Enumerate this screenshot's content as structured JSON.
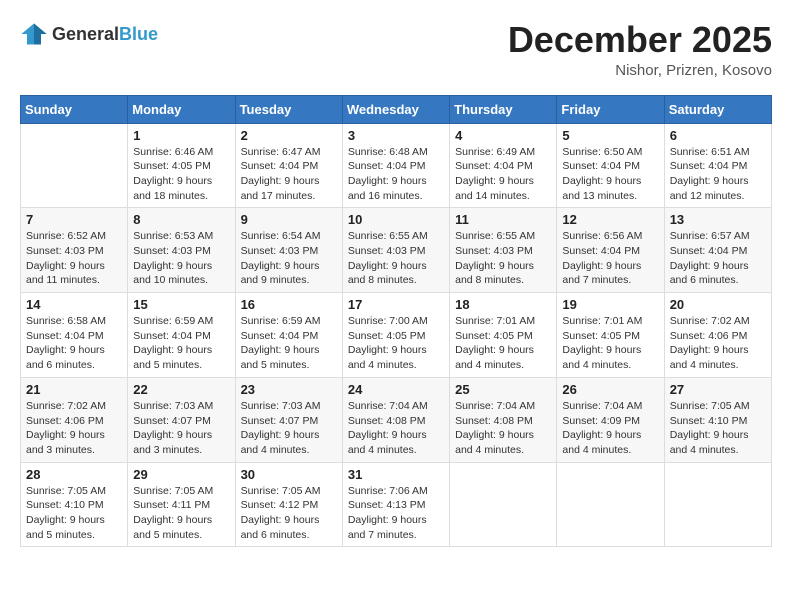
{
  "logo": {
    "general": "General",
    "blue": "Blue"
  },
  "title": {
    "month": "December 2025",
    "location": "Nishor, Prizren, Kosovo"
  },
  "weekdays": [
    "Sunday",
    "Monday",
    "Tuesday",
    "Wednesday",
    "Thursday",
    "Friday",
    "Saturday"
  ],
  "weeks": [
    [
      {
        "day": "",
        "info": ""
      },
      {
        "day": "1",
        "info": "Sunrise: 6:46 AM\nSunset: 4:05 PM\nDaylight: 9 hours\nand 18 minutes."
      },
      {
        "day": "2",
        "info": "Sunrise: 6:47 AM\nSunset: 4:04 PM\nDaylight: 9 hours\nand 17 minutes."
      },
      {
        "day": "3",
        "info": "Sunrise: 6:48 AM\nSunset: 4:04 PM\nDaylight: 9 hours\nand 16 minutes."
      },
      {
        "day": "4",
        "info": "Sunrise: 6:49 AM\nSunset: 4:04 PM\nDaylight: 9 hours\nand 14 minutes."
      },
      {
        "day": "5",
        "info": "Sunrise: 6:50 AM\nSunset: 4:04 PM\nDaylight: 9 hours\nand 13 minutes."
      },
      {
        "day": "6",
        "info": "Sunrise: 6:51 AM\nSunset: 4:04 PM\nDaylight: 9 hours\nand 12 minutes."
      }
    ],
    [
      {
        "day": "7",
        "info": "Sunrise: 6:52 AM\nSunset: 4:03 PM\nDaylight: 9 hours\nand 11 minutes."
      },
      {
        "day": "8",
        "info": "Sunrise: 6:53 AM\nSunset: 4:03 PM\nDaylight: 9 hours\nand 10 minutes."
      },
      {
        "day": "9",
        "info": "Sunrise: 6:54 AM\nSunset: 4:03 PM\nDaylight: 9 hours\nand 9 minutes."
      },
      {
        "day": "10",
        "info": "Sunrise: 6:55 AM\nSunset: 4:03 PM\nDaylight: 9 hours\nand 8 minutes."
      },
      {
        "day": "11",
        "info": "Sunrise: 6:55 AM\nSunset: 4:03 PM\nDaylight: 9 hours\nand 8 minutes."
      },
      {
        "day": "12",
        "info": "Sunrise: 6:56 AM\nSunset: 4:04 PM\nDaylight: 9 hours\nand 7 minutes."
      },
      {
        "day": "13",
        "info": "Sunrise: 6:57 AM\nSunset: 4:04 PM\nDaylight: 9 hours\nand 6 minutes."
      }
    ],
    [
      {
        "day": "14",
        "info": "Sunrise: 6:58 AM\nSunset: 4:04 PM\nDaylight: 9 hours\nand 6 minutes."
      },
      {
        "day": "15",
        "info": "Sunrise: 6:59 AM\nSunset: 4:04 PM\nDaylight: 9 hours\nand 5 minutes."
      },
      {
        "day": "16",
        "info": "Sunrise: 6:59 AM\nSunset: 4:04 PM\nDaylight: 9 hours\nand 5 minutes."
      },
      {
        "day": "17",
        "info": "Sunrise: 7:00 AM\nSunset: 4:05 PM\nDaylight: 9 hours\nand 4 minutes."
      },
      {
        "day": "18",
        "info": "Sunrise: 7:01 AM\nSunset: 4:05 PM\nDaylight: 9 hours\nand 4 minutes."
      },
      {
        "day": "19",
        "info": "Sunrise: 7:01 AM\nSunset: 4:05 PM\nDaylight: 9 hours\nand 4 minutes."
      },
      {
        "day": "20",
        "info": "Sunrise: 7:02 AM\nSunset: 4:06 PM\nDaylight: 9 hours\nand 4 minutes."
      }
    ],
    [
      {
        "day": "21",
        "info": "Sunrise: 7:02 AM\nSunset: 4:06 PM\nDaylight: 9 hours\nand 3 minutes."
      },
      {
        "day": "22",
        "info": "Sunrise: 7:03 AM\nSunset: 4:07 PM\nDaylight: 9 hours\nand 3 minutes."
      },
      {
        "day": "23",
        "info": "Sunrise: 7:03 AM\nSunset: 4:07 PM\nDaylight: 9 hours\nand 4 minutes."
      },
      {
        "day": "24",
        "info": "Sunrise: 7:04 AM\nSunset: 4:08 PM\nDaylight: 9 hours\nand 4 minutes."
      },
      {
        "day": "25",
        "info": "Sunrise: 7:04 AM\nSunset: 4:08 PM\nDaylight: 9 hours\nand 4 minutes."
      },
      {
        "day": "26",
        "info": "Sunrise: 7:04 AM\nSunset: 4:09 PM\nDaylight: 9 hours\nand 4 minutes."
      },
      {
        "day": "27",
        "info": "Sunrise: 7:05 AM\nSunset: 4:10 PM\nDaylight: 9 hours\nand 4 minutes."
      }
    ],
    [
      {
        "day": "28",
        "info": "Sunrise: 7:05 AM\nSunset: 4:10 PM\nDaylight: 9 hours\nand 5 minutes."
      },
      {
        "day": "29",
        "info": "Sunrise: 7:05 AM\nSunset: 4:11 PM\nDaylight: 9 hours\nand 5 minutes."
      },
      {
        "day": "30",
        "info": "Sunrise: 7:05 AM\nSunset: 4:12 PM\nDaylight: 9 hours\nand 6 minutes."
      },
      {
        "day": "31",
        "info": "Sunrise: 7:06 AM\nSunset: 4:13 PM\nDaylight: 9 hours\nand 7 minutes."
      },
      {
        "day": "",
        "info": ""
      },
      {
        "day": "",
        "info": ""
      },
      {
        "day": "",
        "info": ""
      }
    ]
  ]
}
